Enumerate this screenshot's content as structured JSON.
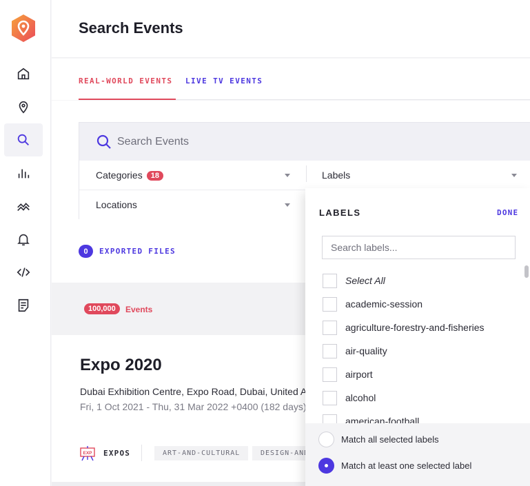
{
  "page": {
    "title": "Search Events"
  },
  "sidebar": {
    "items": [
      {
        "name": "home",
        "icon": "home-icon"
      },
      {
        "name": "location",
        "icon": "map-pin-icon"
      },
      {
        "name": "search",
        "icon": "search-icon",
        "active": true
      },
      {
        "name": "analytics",
        "icon": "bar-chart-icon"
      },
      {
        "name": "features",
        "icon": "trend-icon"
      },
      {
        "name": "notifications",
        "icon": "bell-icon"
      },
      {
        "name": "api",
        "icon": "code-icon"
      },
      {
        "name": "docs",
        "icon": "document-icon"
      }
    ]
  },
  "tabs": [
    {
      "label": "REAL-WORLD EVENTS",
      "active": true
    },
    {
      "label": "LIVE TV EVENTS",
      "active": false
    }
  ],
  "search": {
    "placeholder": "Search Events"
  },
  "filters": {
    "categories": {
      "label": "Categories",
      "count": "18"
    },
    "labels": {
      "label": "Labels"
    },
    "locations": {
      "label": "Locations"
    }
  },
  "exported": {
    "count": "0",
    "label": "EXPORTED FILES"
  },
  "results": {
    "count": "100,000",
    "label": "Events"
  },
  "event": {
    "title": "Expo 2020",
    "location": "Dubai Exhibition Centre, Expo Road, Dubai, United Arab Emirates",
    "dates": "Fri, 1 Oct 2021 - Thu, 31 Mar 2022 +0400 (182 days)",
    "category_icon_text": "EXP",
    "category": "EXPOS",
    "tags": [
      "ART-AND-CULTURAL",
      "DESIGN-AND-ARCHITECTURE"
    ]
  },
  "labels_panel": {
    "heading": "LABELS",
    "done_label": "DONE",
    "search_placeholder": "Search labels...",
    "options": [
      "Select All",
      "academic-session",
      "agriculture-forestry-and-fisheries",
      "air-quality",
      "airport",
      "alcohol",
      "american-football"
    ],
    "match_all": "Match all selected labels",
    "match_any": "Match at least one selected label",
    "selected_match": "match_any"
  },
  "colors": {
    "accent_red": "#e0495c",
    "accent_purple": "#4d38e0",
    "logo_orange": "#f26f4a"
  }
}
